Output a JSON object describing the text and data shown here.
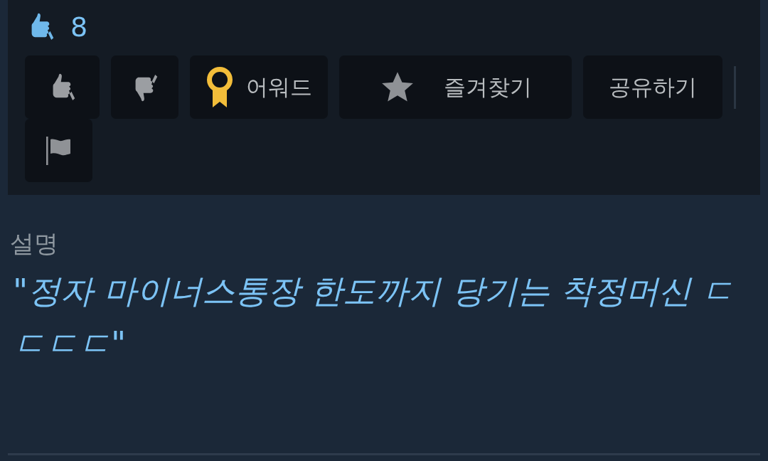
{
  "rating": {
    "count": "8"
  },
  "actions": [
    {
      "kind": "like"
    },
    {
      "kind": "dislike"
    },
    {
      "kind": "award",
      "label": "어워드"
    },
    {
      "kind": "favorite",
      "label": "즐겨찾기"
    },
    {
      "kind": "share",
      "label": "공유하기"
    },
    {
      "kind": "report"
    }
  ],
  "description": {
    "heading": "설명",
    "text": "\"정자 마이너스통장 한도까지 당기는 착정머신 ㄷㄷㄷㄷ\""
  }
}
